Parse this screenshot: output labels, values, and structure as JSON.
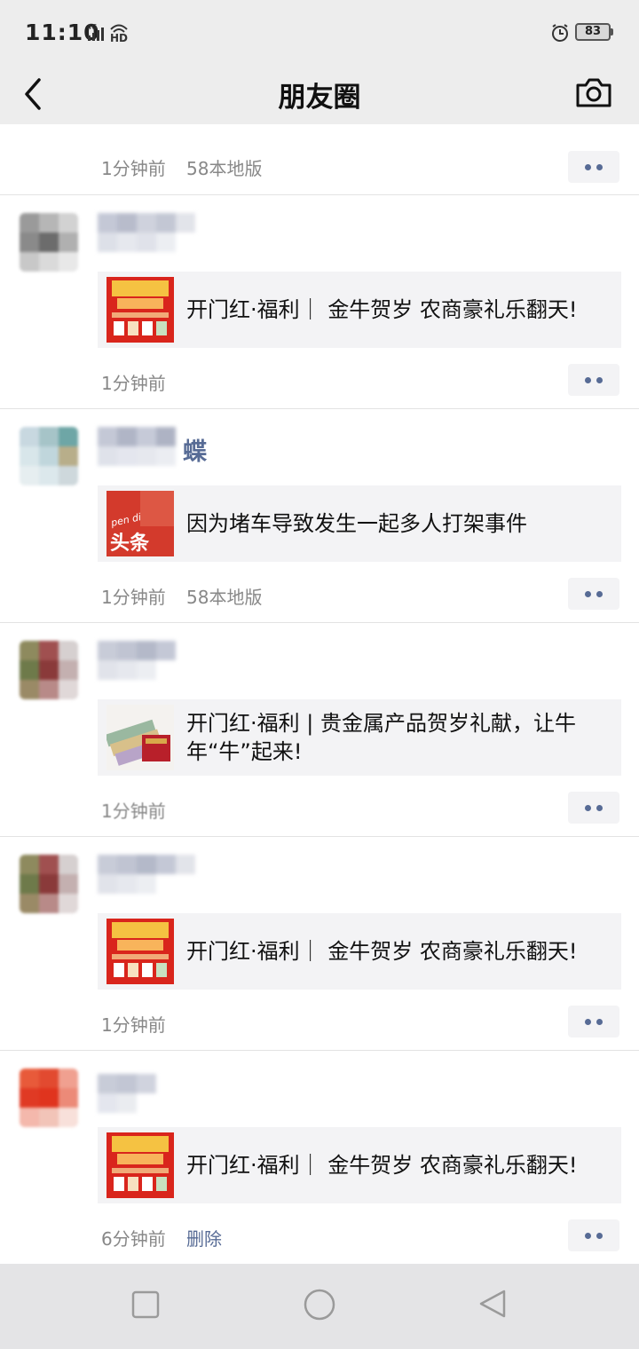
{
  "status_bar": {
    "time": "11:10",
    "network": "4G",
    "hd": "HD",
    "battery": "83"
  },
  "nav": {
    "title": "朋友圈",
    "back_icon": "chevron-left-icon",
    "camera_icon": "camera-icon"
  },
  "posts": [
    {
      "time": "1分钟前",
      "source": "58本地版"
    },
    {
      "link_title": "开门红·福利｜ 金牛贺岁 农商豪礼乐翻天!",
      "thumb": "red-promo-thumbnail",
      "time": "1分钟前"
    },
    {
      "name_suffix": "蝶",
      "link_title": "因为堵车导致发生一起多人打架事件",
      "thumb": "toutiao-thumbnail",
      "thumb_text": "头条",
      "thumb_small_text": "pen di",
      "time": "1分钟前",
      "source": "58本地版"
    },
    {
      "link_title": "开门红·福利 | 贵金属产品贺岁礼献，让牛年“牛”起来!",
      "thumb": "banknotes-thumbnail",
      "time": "1分钟前"
    },
    {
      "link_title": "开门红·福利｜ 金牛贺岁 农商豪礼乐翻天!",
      "thumb": "red-promo-thumbnail",
      "time": "1分钟前"
    },
    {
      "link_title": "开门红·福利｜ 金牛贺岁 农商豪礼乐翻天!",
      "thumb": "red-promo-thumbnail",
      "time": "6分钟前",
      "action": "删除"
    }
  ],
  "colors": {
    "link_blue": "#576b95",
    "meta_gray": "#888888",
    "card_bg": "#f3f3f5",
    "page_bg": "#ededed",
    "promo_red": "#d9251c"
  },
  "system_nav": [
    "recent-apps-icon",
    "home-icon",
    "back-triangle-icon"
  ]
}
